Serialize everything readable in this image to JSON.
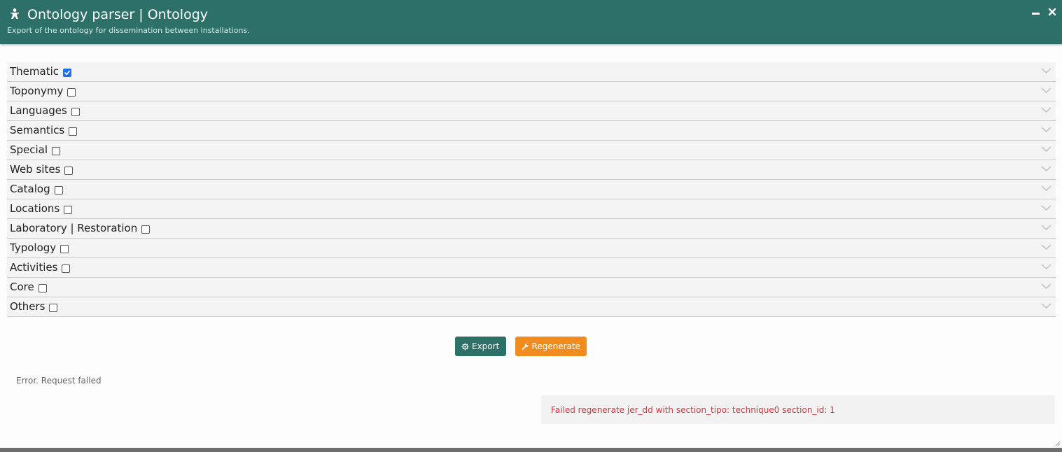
{
  "header": {
    "title": "Ontology parser | Ontology",
    "subtitle": "Export of the ontology for dissemination between installations.",
    "icon": "tool-figure-icon",
    "minimize_icon": "minimize-icon",
    "close_icon": "close-icon",
    "background_color": "#2d7067"
  },
  "sections": [
    {
      "label": "Thematic",
      "checked": true
    },
    {
      "label": "Toponymy",
      "checked": false
    },
    {
      "label": "Languages",
      "checked": false
    },
    {
      "label": "Semantics",
      "checked": false
    },
    {
      "label": "Special",
      "checked": false
    },
    {
      "label": "Web sites",
      "checked": false
    },
    {
      "label": "Catalog",
      "checked": false
    },
    {
      "label": "Locations",
      "checked": false
    },
    {
      "label": "Laboratory | Restoration",
      "checked": false
    },
    {
      "label": "Typology",
      "checked": false
    },
    {
      "label": "Activities",
      "checked": false
    },
    {
      "label": "Core",
      "checked": false
    },
    {
      "label": "Others",
      "checked": false
    }
  ],
  "actions": {
    "export_label": "Export",
    "export_icon": "gear-icon",
    "export_color": "#2d7067",
    "regenerate_label": "Regenerate",
    "regenerate_icon": "wrench-icon",
    "regenerate_color": "#f38c1e"
  },
  "status": {
    "request_message": "Error. Request failed",
    "error_message": "Failed regenerate jer_dd with section_tipo: technique0 section_id: 1",
    "error_color": "#d9363e"
  }
}
